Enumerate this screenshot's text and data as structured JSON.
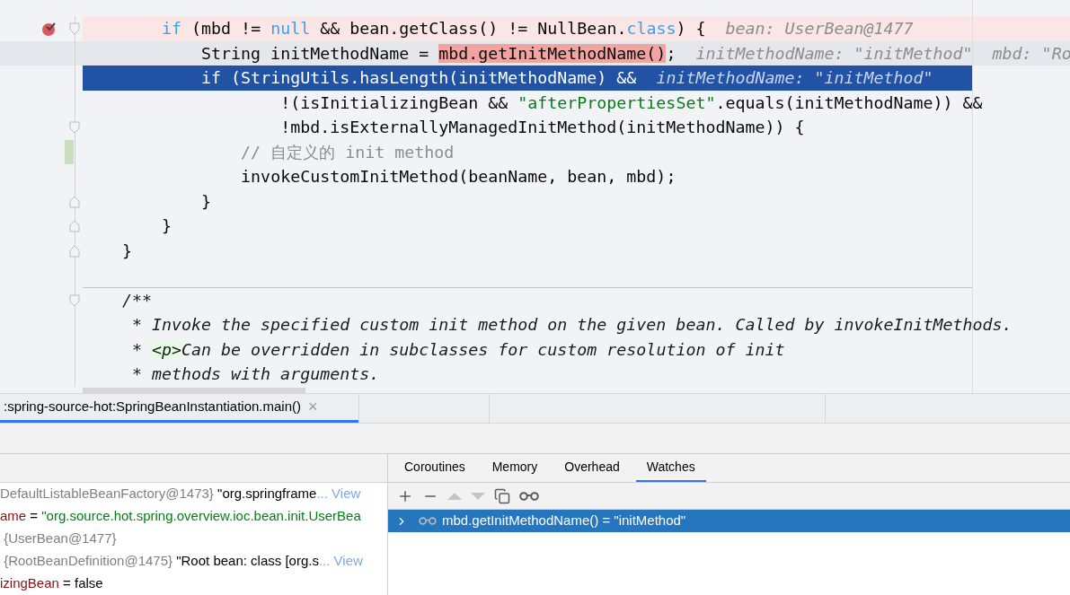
{
  "editor": {
    "lines": [
      {
        "breakpoint": true,
        "changed": false,
        "current": false,
        "selected": false,
        "fold_start": true,
        "fold_end": false,
        "tokens": [
          {
            "kind": "keyword",
            "text": "        if"
          },
          {
            "kind": "plain",
            "text": " (mbd != "
          },
          {
            "kind": "keyword",
            "text": "null"
          },
          {
            "kind": "plain",
            "text": " && bean.getClass() != NullBean."
          },
          {
            "kind": "keyword",
            "text": "class"
          },
          {
            "kind": "plain",
            "text": ") {"
          },
          {
            "kind": "hint",
            "text": "bean: UserBean@1477"
          }
        ]
      },
      {
        "breakpoint": false,
        "changed": false,
        "current": true,
        "selected": false,
        "fold_start": false,
        "fold_end": false,
        "tokens": [
          {
            "kind": "plain",
            "text": "            String initMethodName = "
          },
          {
            "kind": "eval",
            "text": "mbd.getInitMethodName()"
          },
          {
            "kind": "plain",
            "text": ";"
          },
          {
            "kind": "hint",
            "text": "initMethodName: \"initMethod\"  mbd: \"Ro"
          }
        ]
      },
      {
        "breakpoint": false,
        "changed": false,
        "current": false,
        "selected": true,
        "fold_start": false,
        "fold_end": false,
        "tokens": [
          {
            "kind": "keyword",
            "text": "            if"
          },
          {
            "kind": "plain",
            "text": " (StringUtils.hasLength(initMethodName) &&"
          },
          {
            "kind": "hint",
            "text": "initMethodName: \"initMethod\""
          }
        ]
      },
      {
        "breakpoint": false,
        "changed": false,
        "current": false,
        "selected": false,
        "fold_start": false,
        "fold_end": false,
        "tokens": [
          {
            "kind": "plain",
            "text": "                    !(isInitializingBean && "
          },
          {
            "kind": "string",
            "text": "\"afterPropertiesSet\""
          },
          {
            "kind": "plain",
            "text": ".equals(initMethodName)) &&"
          }
        ]
      },
      {
        "breakpoint": false,
        "changed": false,
        "current": false,
        "selected": false,
        "fold_start": true,
        "fold_end": false,
        "tokens": [
          {
            "kind": "plain",
            "text": "                    !mbd.isExternallyManagedInitMethod(initMethodName)) {"
          }
        ]
      },
      {
        "breakpoint": false,
        "changed": true,
        "current": false,
        "selected": false,
        "fold_start": false,
        "fold_end": false,
        "tokens": [
          {
            "kind": "comment",
            "text": "                // 自定义的 init method"
          }
        ]
      },
      {
        "breakpoint": false,
        "changed": false,
        "current": false,
        "selected": false,
        "fold_start": false,
        "fold_end": false,
        "tokens": [
          {
            "kind": "plain",
            "text": "                invokeCustomInitMethod(beanName, bean, mbd);"
          }
        ]
      },
      {
        "breakpoint": false,
        "changed": false,
        "current": false,
        "selected": false,
        "fold_start": false,
        "fold_end": true,
        "tokens": [
          {
            "kind": "plain",
            "text": "            }"
          }
        ]
      },
      {
        "breakpoint": false,
        "changed": false,
        "current": false,
        "selected": false,
        "fold_start": false,
        "fold_end": true,
        "tokens": [
          {
            "kind": "plain",
            "text": "        }"
          }
        ]
      },
      {
        "breakpoint": false,
        "changed": false,
        "current": false,
        "selected": false,
        "fold_start": false,
        "fold_end": true,
        "tokens": [
          {
            "kind": "plain",
            "text": "    }"
          }
        ]
      },
      {
        "breakpoint": false,
        "changed": false,
        "current": false,
        "selected": false,
        "fold_start": false,
        "fold_end": false,
        "kind": "separator"
      },
      {
        "breakpoint": false,
        "changed": false,
        "current": false,
        "selected": false,
        "fold_start": true,
        "fold_end": false,
        "tokens": [
          {
            "kind": "doc",
            "text": "    /**"
          }
        ]
      },
      {
        "breakpoint": false,
        "changed": false,
        "current": false,
        "selected": false,
        "fold_start": false,
        "fold_end": false,
        "tokens": [
          {
            "kind": "doc",
            "text": "     * Invoke the specified custom init method on the given bean. Called by invokeInitMethods."
          }
        ]
      },
      {
        "breakpoint": false,
        "changed": false,
        "current": false,
        "selected": false,
        "fold_start": false,
        "fold_end": false,
        "tokens": [
          {
            "kind": "doc",
            "text": "     * "
          },
          {
            "kind": "tag",
            "text": "<p>"
          },
          {
            "kind": "doc",
            "text": "Can be overridden in subclasses for custom resolution of init"
          }
        ]
      },
      {
        "breakpoint": false,
        "changed": false,
        "current": false,
        "selected": false,
        "fold_start": false,
        "fold_end": false,
        "tokens": [
          {
            "kind": "doc",
            "text": "     * methods with arguments."
          }
        ]
      }
    ]
  },
  "debug_tabs": [
    {
      "label": ":spring-source-hot:SpringBeanInstantiation.main()",
      "close": "×",
      "selected": true
    }
  ],
  "variables": [
    [
      {
        "kind": "type",
        "text": "DefaultListableBeanFactory@1473}"
      },
      {
        "kind": "value",
        "text": " \"org.springframe"
      },
      {
        "kind": "link",
        "text": "... View"
      }
    ],
    [
      {
        "kind": "name",
        "text": "ame"
      },
      {
        "kind": "value",
        "text": " = "
      },
      {
        "kind": "string",
        "text": "\"org.source.hot.spring.overview.ioc.bean.init.UserBea"
      }
    ],
    [
      {
        "kind": "type",
        "text": " {UserBean@1477}"
      }
    ],
    [
      {
        "kind": "type",
        "text": " {RootBeanDefinition@1475}"
      },
      {
        "kind": "value",
        "text": " \"Root bean: class [org.s"
      },
      {
        "kind": "link",
        "text": "... View"
      }
    ],
    [
      {
        "kind": "name",
        "text": "izingBean"
      },
      {
        "kind": "value",
        "text": " = false"
      }
    ]
  ],
  "watches_panel": {
    "tabs": [
      {
        "label": "Coroutines",
        "selected": false
      },
      {
        "label": "Memory",
        "selected": false
      },
      {
        "label": "Overhead",
        "selected": false
      },
      {
        "label": "Watches",
        "selected": true
      }
    ],
    "toolbar": [
      {
        "kind": "add",
        "disabled": false
      },
      {
        "kind": "remove",
        "disabled": false
      },
      {
        "kind": "up",
        "disabled": true
      },
      {
        "kind": "down",
        "disabled": true
      },
      {
        "kind": "copy",
        "disabled": false
      },
      {
        "kind": "glasses",
        "disabled": false
      }
    ],
    "watches": [
      {
        "expression": "mbd.getInitMethodName() = \"initMethod\"",
        "selected": true
      }
    ]
  }
}
